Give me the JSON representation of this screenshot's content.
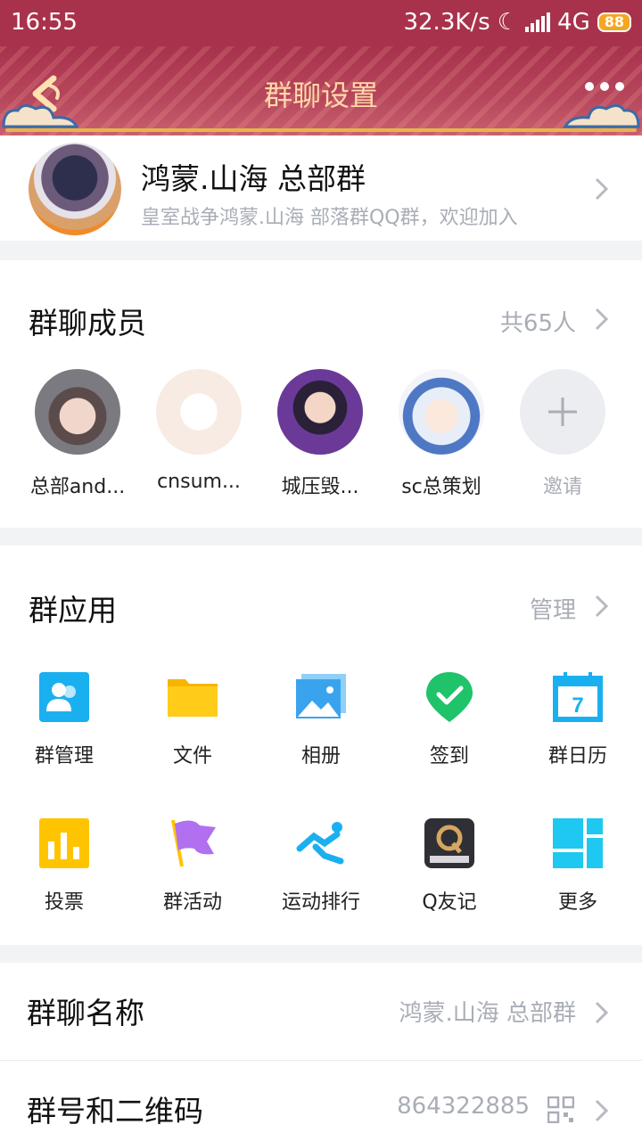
{
  "status_bar": {
    "time": "16:55",
    "net_speed": "32.3K/s",
    "network": "4G",
    "battery": "88"
  },
  "nav": {
    "title": "群聊设置"
  },
  "group": {
    "name": "鸿蒙.山海 总部群",
    "description": "皇室战争鸿蒙.山海 部落群QQ群，欢迎加入"
  },
  "members": {
    "title": "群聊成员",
    "count": "共65人",
    "list": [
      {
        "name": "总部and..."
      },
      {
        "name": "cnsum..."
      },
      {
        "name": "城压毁..."
      },
      {
        "name": "sc总策划"
      }
    ],
    "invite_label": "邀请"
  },
  "apps": {
    "title": "群应用",
    "manage": "管理",
    "items": [
      {
        "label": "群管理",
        "icon": "group-manage-icon"
      },
      {
        "label": "文件",
        "icon": "folder-icon"
      },
      {
        "label": "相册",
        "icon": "photo-album-icon"
      },
      {
        "label": "签到",
        "icon": "check-in-icon"
      },
      {
        "label": "群日历",
        "icon": "calendar-icon"
      },
      {
        "label": "投票",
        "icon": "vote-icon"
      },
      {
        "label": "群活动",
        "icon": "flag-icon"
      },
      {
        "label": "运动排行",
        "icon": "running-icon"
      },
      {
        "label": "Q友记",
        "icon": "notebook-icon"
      },
      {
        "label": "更多",
        "icon": "grid-icon"
      }
    ]
  },
  "settings": {
    "group_name_label": "群聊名称",
    "group_name_value": "鸿蒙.山海 总部群",
    "group_id_label": "群号和二维码",
    "group_id_value": "864322885"
  },
  "colors": {
    "header": "#a8324c",
    "title_gold": "#ffd9a8",
    "muted": "#a9adb6"
  }
}
